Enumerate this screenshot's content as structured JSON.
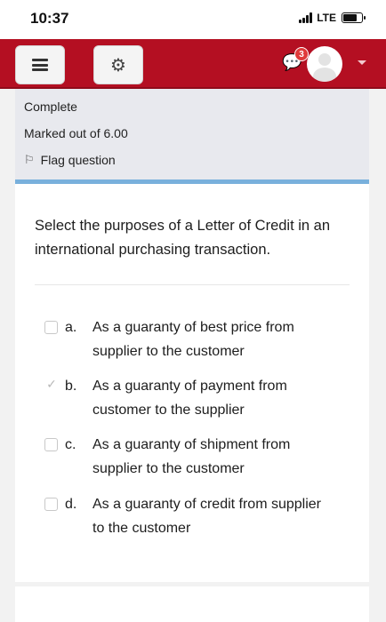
{
  "status_bar": {
    "time": "10:37",
    "network": "LTE"
  },
  "navbar": {
    "message_badge": "3"
  },
  "info": {
    "state": "Complete",
    "mark": "Marked out of 6.00",
    "flag_label": "Flag question"
  },
  "question": {
    "text": "Select the purposes of a Letter of Credit in an international purchasing transaction.",
    "options": [
      {
        "letter": "a.",
        "text": "As a guaranty of best price from supplier to the customer",
        "checked": false
      },
      {
        "letter": "b.",
        "text": "As a guaranty of payment from customer to the supplier",
        "checked": true
      },
      {
        "letter": "c.",
        "text": "As a guaranty of shipment from supplier to the customer",
        "checked": false
      },
      {
        "letter": "d.",
        "text": "As a guaranty of credit from supplier to the customer",
        "checked": false
      }
    ]
  },
  "colors": {
    "navbar": "#b40f22",
    "accent": "#79b0dc",
    "badge": "#e03a3a"
  },
  "icons": [
    "hamburger-menu-icon",
    "gear-icon",
    "chat-icon",
    "avatar-icon",
    "caret-down-icon",
    "flag-icon",
    "checkmark-icon"
  ]
}
